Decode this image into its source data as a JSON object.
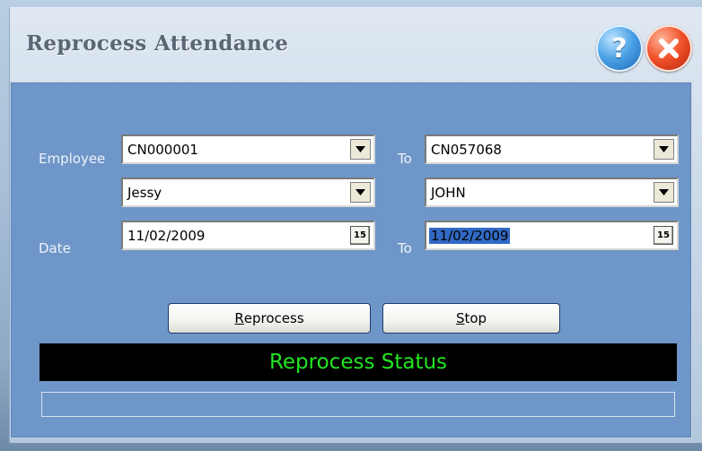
{
  "window": {
    "title": "Reprocess Attendance",
    "help_glyph": "?",
    "icons": {
      "help": "help-icon",
      "close": "close-icon"
    }
  },
  "form": {
    "employee_label": "Employee",
    "to_label": "To",
    "date_label": "Date",
    "employee_from_code": "CN000001",
    "employee_to_code": "CN057068",
    "employee_from_name": "Jessy",
    "employee_to_name": "JOHN",
    "date_from": "11/02/2009",
    "date_to": "11/02/2009",
    "calendar_glyph": "15"
  },
  "buttons": {
    "reprocess_mnemonic": "R",
    "reprocess_rest": "eprocess",
    "stop_mnemonic": "S",
    "stop_rest": "top"
  },
  "status": {
    "text": "Reprocess Status",
    "progress": 0
  },
  "colors": {
    "panel": "#6f96c8",
    "status_bg": "#000000",
    "status_text": "#22e522"
  }
}
